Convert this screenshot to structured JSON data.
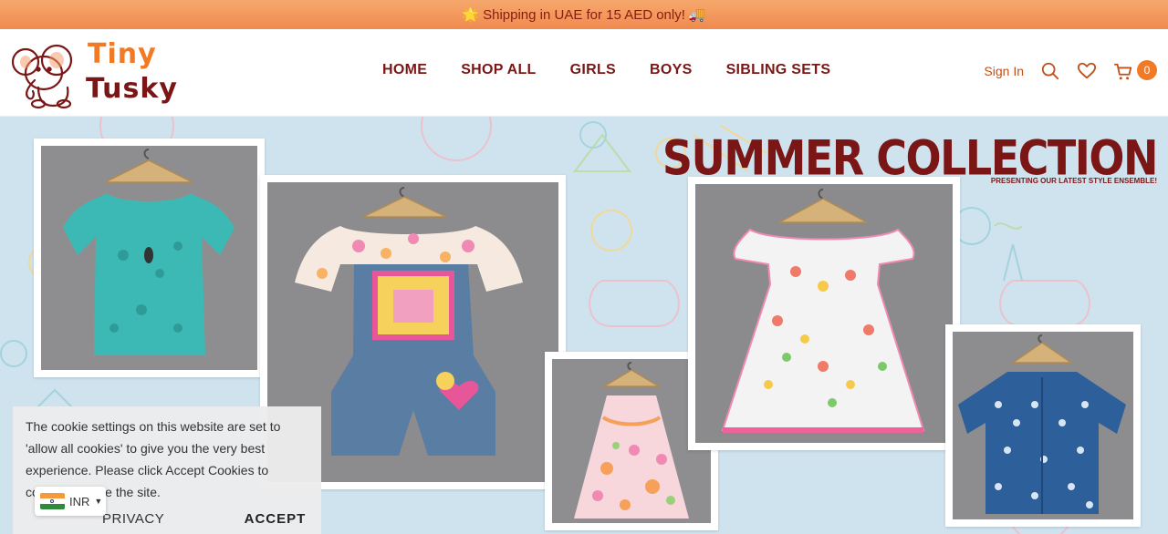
{
  "announcement": {
    "text": "Shipping in UAE for 15 AED only!",
    "icon_left": "sparkle-icon",
    "icon_right": "truck-icon"
  },
  "brand": {
    "name_line1": "Tiny",
    "name_line2": "Tusky",
    "logo_icon": "elephant-icon"
  },
  "nav": {
    "items": [
      "HOME",
      "SHOP ALL",
      "GIRLS",
      "BOYS",
      "SIBLING SETS"
    ]
  },
  "header_actions": {
    "signin_label": "Sign In",
    "cart_count": "0",
    "icons": [
      "search-icon",
      "heart-icon",
      "cart-icon"
    ]
  },
  "hero": {
    "title": "SUMMER COLLECTION",
    "subtitle": "PRESENTING OUR LATEST STYLE ENSEMBLE!"
  },
  "cookie": {
    "text": "The cookie settings on this website are set to 'allow all cookies' to give you the very best experience. Please click Accept Cookies to continue to use the site.",
    "privacy_label": "PRIVACY POLICY",
    "accept_label": "ACCEPT ✓"
  },
  "currency": {
    "code": "INR",
    "flag": "india-flag-icon"
  },
  "colors": {
    "brand_orange": "#f07a25",
    "brand_maroon": "#7b1616",
    "hero_bg": "#cfe3ef"
  }
}
